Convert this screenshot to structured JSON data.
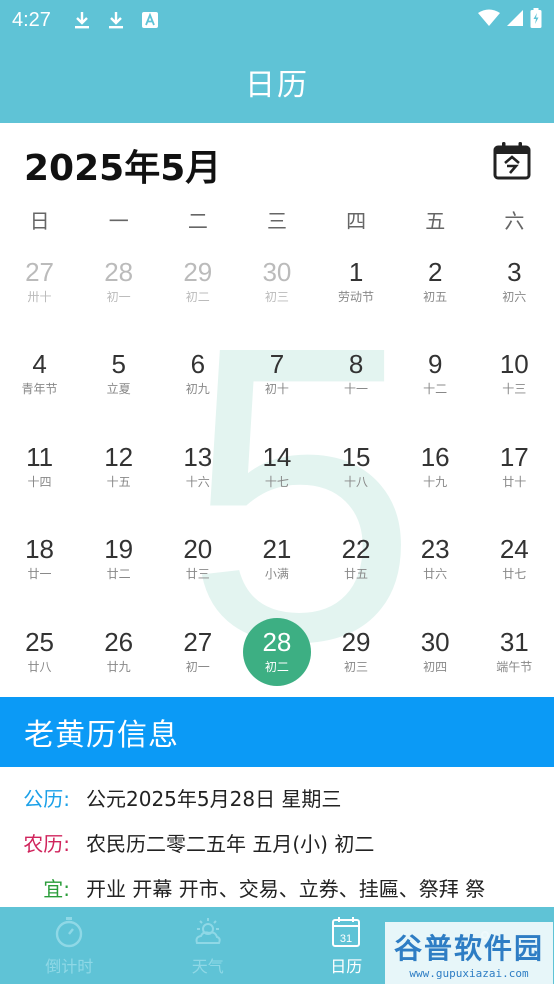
{
  "status": {
    "time": "4:27"
  },
  "header": {
    "title": "日历"
  },
  "calendar": {
    "month_title": "2025年5月",
    "watermark_month": "5",
    "weekdays": [
      "日",
      "一",
      "二",
      "三",
      "四",
      "五",
      "六"
    ],
    "weeks": [
      [
        {
          "d": "27",
          "l": "卅十",
          "muted": true
        },
        {
          "d": "28",
          "l": "初一",
          "muted": true
        },
        {
          "d": "29",
          "l": "初二",
          "muted": true
        },
        {
          "d": "30",
          "l": "初三",
          "muted": true
        },
        {
          "d": "1",
          "l": "劳动节"
        },
        {
          "d": "2",
          "l": "初五"
        },
        {
          "d": "3",
          "l": "初六"
        }
      ],
      [
        {
          "d": "4",
          "l": "青年节"
        },
        {
          "d": "5",
          "l": "立夏"
        },
        {
          "d": "6",
          "l": "初九"
        },
        {
          "d": "7",
          "l": "初十"
        },
        {
          "d": "8",
          "l": "十一"
        },
        {
          "d": "9",
          "l": "十二"
        },
        {
          "d": "10",
          "l": "十三"
        }
      ],
      [
        {
          "d": "11",
          "l": "十四"
        },
        {
          "d": "12",
          "l": "十五"
        },
        {
          "d": "13",
          "l": "十六"
        },
        {
          "d": "14",
          "l": "十七"
        },
        {
          "d": "15",
          "l": "十八"
        },
        {
          "d": "16",
          "l": "十九"
        },
        {
          "d": "17",
          "l": "廿十"
        }
      ],
      [
        {
          "d": "18",
          "l": "廿一"
        },
        {
          "d": "19",
          "l": "廿二"
        },
        {
          "d": "20",
          "l": "廿三"
        },
        {
          "d": "21",
          "l": "小满"
        },
        {
          "d": "22",
          "l": "廿五"
        },
        {
          "d": "23",
          "l": "廿六"
        },
        {
          "d": "24",
          "l": "廿七"
        }
      ],
      [
        {
          "d": "25",
          "l": "廿八"
        },
        {
          "d": "26",
          "l": "廿九"
        },
        {
          "d": "27",
          "l": "初一"
        },
        {
          "d": "28",
          "l": "初二",
          "selected": true
        },
        {
          "d": "29",
          "l": "初三"
        },
        {
          "d": "30",
          "l": "初四"
        },
        {
          "d": "31",
          "l": "端午节"
        }
      ]
    ]
  },
  "almanac": {
    "heading": "老黄历信息",
    "gregorian_label": "公历:",
    "gregorian_value": "公元2025年5月28日 星期三",
    "lunar_label": "农历:",
    "lunar_value": "农民历二零二五年 五月(小) 初二",
    "yi_label": "宜:",
    "yi_value": "开业 开幕 开市、交易、立券、挂匾、祭拜 祭"
  },
  "nav": [
    {
      "label": "倒计时",
      "icon": "stopwatch-icon"
    },
    {
      "label": "天气",
      "icon": "weather-icon"
    },
    {
      "label": "日历",
      "icon": "calendar-icon",
      "active": true
    },
    {
      "label": "",
      "icon": "more-icon"
    }
  ],
  "watermark": {
    "brand": "谷普软件园",
    "url": "www.gupuxiazai.com"
  },
  "colors": {
    "primary": "#5fc3d6",
    "selected": "#3daf83",
    "info_header": "#0b9af6",
    "gregorian_label": "#1aa0e8",
    "lunar_label": "#d0245c",
    "yi_label": "#2a9d3a"
  }
}
